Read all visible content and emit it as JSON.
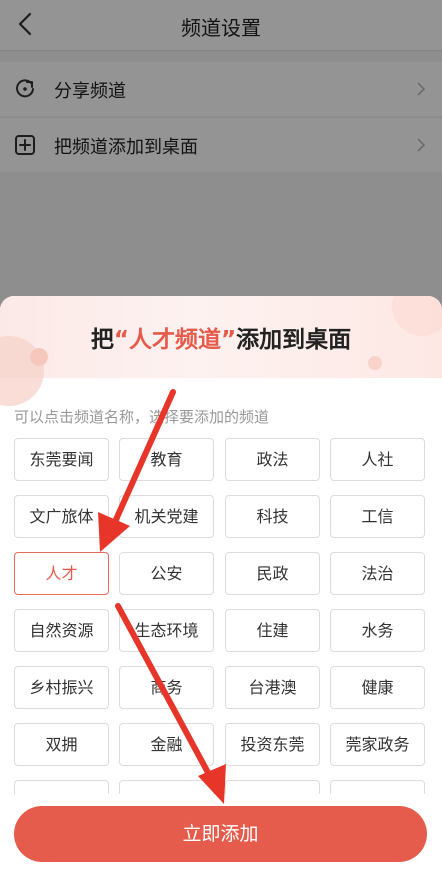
{
  "nav": {
    "title": "频道设置"
  },
  "menu": [
    {
      "label": "分享频道",
      "icon": "share-refresh-icon"
    },
    {
      "label": "把频道添加到桌面",
      "icon": "add-square-icon"
    }
  ],
  "sheet": {
    "title_prefix": "把",
    "title_highlight": "“人才频道”",
    "title_suffix": "添加到桌面",
    "hint": "可以点击频道名称，选择要添加的频道",
    "selected": "人才",
    "channels": [
      "东莞要闻",
      "教育",
      "政法",
      "人社",
      "文广旅体",
      "机关党建",
      "科技",
      "工信",
      "人才",
      "公安",
      "民政",
      "法治",
      "自然资源",
      "生态环境",
      "住建",
      "水务",
      "乡村振兴",
      "商务",
      "台港澳",
      "健康",
      "双拥",
      "金融",
      "投资东莞",
      "莞家政务"
    ],
    "add_button": "立即添加"
  },
  "colors": {
    "accent": "#e55b4b",
    "button": "#e65c4c",
    "arrow": "#e8352a"
  }
}
